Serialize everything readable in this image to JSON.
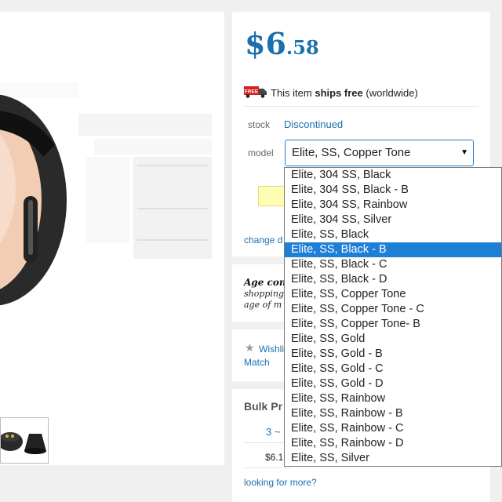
{
  "price": {
    "currency": "$",
    "dollars": "6",
    "cents": ".58"
  },
  "shipping": {
    "badge": "FREE",
    "text_before": "This item ",
    "bold": "ships free",
    "text_after": " (worldwide)"
  },
  "stock": {
    "label": "stock",
    "value": "Discontinued"
  },
  "model": {
    "label": "model",
    "selected": "Elite, SS, Copper Tone",
    "options": [
      "Elite, 304 SS, Black",
      "Elite, 304 SS, Black - B",
      "Elite, 304 SS, Rainbow",
      "Elite, 304 SS, Silver",
      "Elite, SS, Black",
      "Elite, SS, Black - B",
      "Elite, SS, Black - C",
      "Elite, SS, Black - D",
      "Elite, SS, Copper Tone",
      "Elite, SS, Copper Tone - C",
      "Elite, SS, Copper Tone- B",
      "Elite, SS, Gold",
      "Elite, SS, Gold - B",
      "Elite, SS, Gold - C",
      "Elite, SS, Gold - D",
      "Elite, SS, Rainbow",
      "Elite, SS, Rainbow - B",
      "Elite, SS, Rainbow - C",
      "Elite, SS, Rainbow - D",
      "Elite, SS, Silver"
    ],
    "highlighted_option": "Elite, SS, Black - B"
  },
  "change_link": "change d",
  "age": {
    "title": "Age con",
    "line1": "shopping",
    "line2": "age of m"
  },
  "wishlist": {
    "label": "Wishli",
    "match": "Match"
  },
  "bulk": {
    "title": "Bulk Pr",
    "qty": "3 ~",
    "price": "$6.1"
  },
  "looking": "looking for more?",
  "colors": {
    "accent": "#1a6fae",
    "selection": "#1e7fd6"
  }
}
